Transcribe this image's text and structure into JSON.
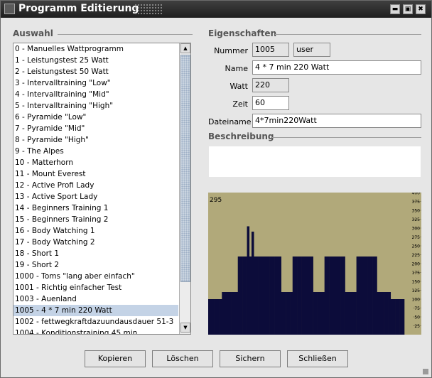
{
  "window": {
    "title": "Programm Editierung",
    "min_btn": "▬",
    "max_btn": "▣",
    "close_btn": "✖"
  },
  "auswahl": {
    "heading": "Auswahl",
    "selected_index": 24,
    "items": [
      "0 - Manuelles Wattprogramm",
      "1 - Leistungstest 25 Watt",
      "2 - Leistungstest 50 Watt",
      "3 - Intervalltraining \"Low\"",
      "4 - Intervalltraining \"Mid\"",
      "5 - Intervalltraining \"High\"",
      "6 - Pyramide \"Low\"",
      "7 - Pyramide \"Mid\"",
      "8 - Pyramide \"High\"",
      "9 - The Alpes",
      "10 - Matterhorn",
      "11 - Mount Everest",
      "12 - Active Profi Lady",
      "13 - Active Sport Lady",
      "14 - Beginners Training 1",
      "15 - Beginners Training 2",
      "16 - Body Watching 1",
      "17 - Body Watching 2",
      "18 - Short 1",
      "19 - Short 2",
      "1000 - Toms \"lang aber einfach\"",
      "1001 - Richtig einfacher Test",
      "1003 - Auenland",
      "1005 - 4 * 7 min 220 Watt",
      "1002 - fettwegkraftdazuundausdauer 51-3",
      "1004 - Konditionstraining 45 min"
    ]
  },
  "eigenschaften": {
    "heading": "Eigenschaften",
    "nummer_label": "Nummer",
    "nummer": "1005",
    "owner": "user",
    "name_label": "Name",
    "name": "4 * 7 min 220 Watt",
    "watt_label": "Watt",
    "watt": "220",
    "zeit_label": "Zeit",
    "zeit": "60",
    "dateiname_label": "Dateiname",
    "dateiname": "4*7min220Watt"
  },
  "beschreibung": {
    "heading": "Beschreibung",
    "text": ""
  },
  "chart_data": {
    "type": "bar",
    "max_label": "295",
    "y_ticks": [
      25,
      50,
      75,
      100,
      125,
      150,
      175,
      200,
      225,
      250,
      275,
      300,
      325,
      350,
      375,
      400
    ],
    "ylim": [
      0,
      400
    ],
    "values": [
      100,
      100,
      100,
      100,
      100,
      100,
      120,
      120,
      120,
      120,
      120,
      120,
      120,
      220,
      220,
      220,
      220,
      305,
      220,
      290,
      220,
      220,
      220,
      220,
      220,
      220,
      220,
      220,
      220,
      220,
      220,
      220,
      120,
      120,
      120,
      120,
      120,
      220,
      220,
      220,
      220,
      220,
      220,
      220,
      220,
      220,
      120,
      120,
      120,
      120,
      120,
      220,
      220,
      220,
      220,
      220,
      220,
      220,
      220,
      220,
      120,
      120,
      120,
      120,
      120,
      220,
      220,
      220,
      220,
      220,
      220,
      220,
      220,
      220,
      120,
      120,
      120,
      120,
      120,
      120,
      100,
      100,
      100,
      100,
      100,
      100
    ],
    "bar_color": "#0c0c3a",
    "bg_color": "#b1a97a"
  },
  "buttons": {
    "kopieren": "Kopieren",
    "loeschen": "Löschen",
    "sichern": "Sichern",
    "schliessen": "Schließen"
  }
}
